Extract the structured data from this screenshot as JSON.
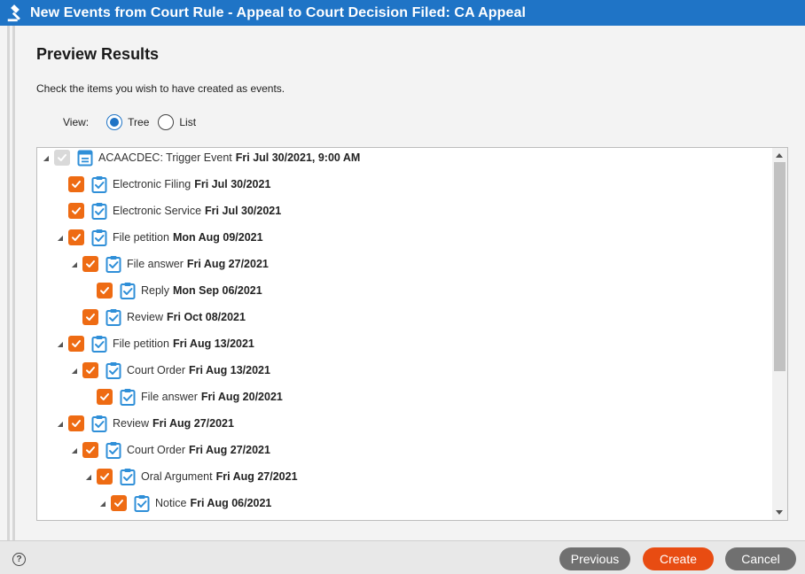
{
  "window": {
    "title": "New Events from Court Rule - Appeal to Court Decision Filed: CA Appeal",
    "icon": "gavel-icon"
  },
  "heading": "Preview Results",
  "instruction": "Check the items you wish to have created as events.",
  "view": {
    "label": "View:",
    "options": [
      {
        "label": "Tree",
        "selected": true
      },
      {
        "label": "List",
        "selected": false
      }
    ]
  },
  "tree": {
    "rows": [
      {
        "name": "ACAACDEC: Trigger Event",
        "date": "Fri Jul 30/2021, 9:00 AM",
        "level": 0,
        "expandable": true,
        "checked": true,
        "disabled": true,
        "icon": "calendar-icon"
      },
      {
        "name": "Electronic Filing",
        "date": "Fri Jul 30/2021",
        "level": 1,
        "expandable": false,
        "checked": true,
        "icon": "clipboard-check-icon"
      },
      {
        "name": "Electronic Service",
        "date": "Fri Jul 30/2021",
        "level": 1,
        "expandable": false,
        "checked": true,
        "icon": "clipboard-check-icon"
      },
      {
        "name": "File petition",
        "date": "Mon Aug 09/2021",
        "level": 1,
        "expandable": true,
        "checked": true,
        "icon": "clipboard-check-icon"
      },
      {
        "name": "File answer",
        "date": "Fri Aug 27/2021",
        "level": 2,
        "expandable": true,
        "checked": true,
        "icon": "clipboard-check-icon"
      },
      {
        "name": "Reply",
        "date": "Mon Sep 06/2021",
        "level": 3,
        "expandable": false,
        "checked": true,
        "icon": "clipboard-check-icon"
      },
      {
        "name": "Review",
        "date": "Fri Oct 08/2021",
        "level": 2,
        "expandable": false,
        "checked": true,
        "icon": "clipboard-check-icon"
      },
      {
        "name": "File petition",
        "date": "Fri Aug 13/2021",
        "level": 1,
        "expandable": true,
        "checked": true,
        "icon": "clipboard-check-icon"
      },
      {
        "name": "Court Order",
        "date": "Fri Aug 13/2021",
        "level": 2,
        "expandable": true,
        "checked": true,
        "icon": "clipboard-check-icon"
      },
      {
        "name": "File answer",
        "date": "Fri Aug 20/2021",
        "level": 3,
        "expandable": false,
        "checked": true,
        "icon": "clipboard-check-icon"
      },
      {
        "name": "Review",
        "date": "Fri Aug 27/2021",
        "level": 1,
        "expandable": true,
        "checked": true,
        "icon": "clipboard-check-icon"
      },
      {
        "name": "Court Order",
        "date": "Fri Aug 27/2021",
        "level": 2,
        "expandable": true,
        "checked": true,
        "icon": "clipboard-check-icon"
      },
      {
        "name": "Oral Argument",
        "date": "Fri Aug 27/2021",
        "level": 3,
        "expandable": true,
        "checked": true,
        "icon": "clipboard-check-icon"
      },
      {
        "name": "Notice",
        "date": "Fri Aug 06/2021",
        "level": 4,
        "expandable": true,
        "checked": true,
        "icon": "clipboard-check-icon"
      }
    ]
  },
  "footer": {
    "help_icon": "help-icon",
    "previous_label": "Previous",
    "create_label": "Create",
    "cancel_label": "Cancel"
  },
  "colors": {
    "title_bar": "#1f74c6",
    "checkbox_checked": "#ee6b13",
    "create_button": "#e84c12",
    "secondary_button": "#707070",
    "item_icon": "#2f8fd8"
  }
}
